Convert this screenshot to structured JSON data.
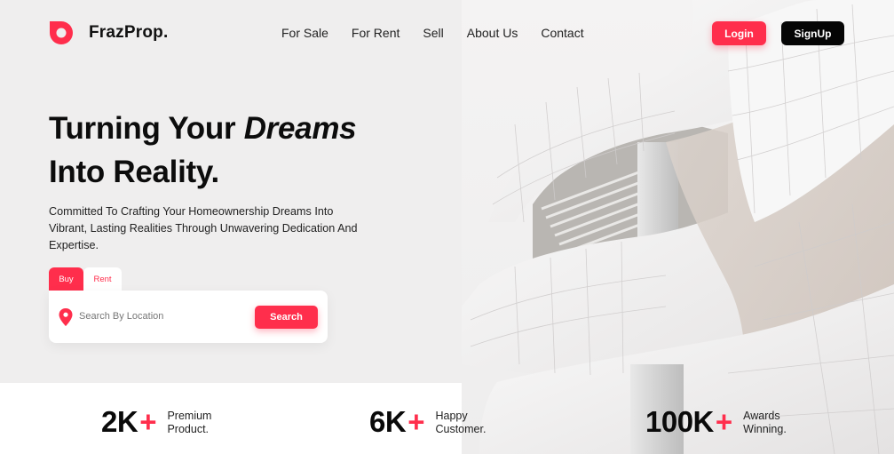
{
  "brand": {
    "name": "FrazProp.",
    "accent": "#ff2e4c",
    "dark": "#050505",
    "logo_icon": "logo-ring-icon"
  },
  "nav": {
    "items": [
      "For Sale",
      "For Rent",
      "Sell",
      "About Us",
      "Contact"
    ]
  },
  "auth": {
    "login_label": "Login",
    "signup_label": "SignUp"
  },
  "hero": {
    "headline_part1": "Turning Your ",
    "headline_emphasis": "Dreams",
    "headline_line2": "Into Reality.",
    "subtext": "Committed To Crafting Your Homeownership Dreams Into Vibrant, Lasting Realities Through Unwavering Dedication And Expertise."
  },
  "search": {
    "tabs": [
      "Buy",
      "Rent"
    ],
    "active_tab": "Buy",
    "placeholder": "Search By Location",
    "button_label": "Search",
    "location_icon": "map-pin-icon"
  },
  "stats": [
    {
      "value": "2K",
      "plus": "+",
      "label_line1": "Premium",
      "label_line2": "Product."
    },
    {
      "value": "6K",
      "plus": "+",
      "label_line1": "Happy",
      "label_line2": "Customer."
    },
    {
      "value": "100K",
      "plus": "+",
      "label_line1": "Awards",
      "label_line2": "Winning."
    }
  ]
}
